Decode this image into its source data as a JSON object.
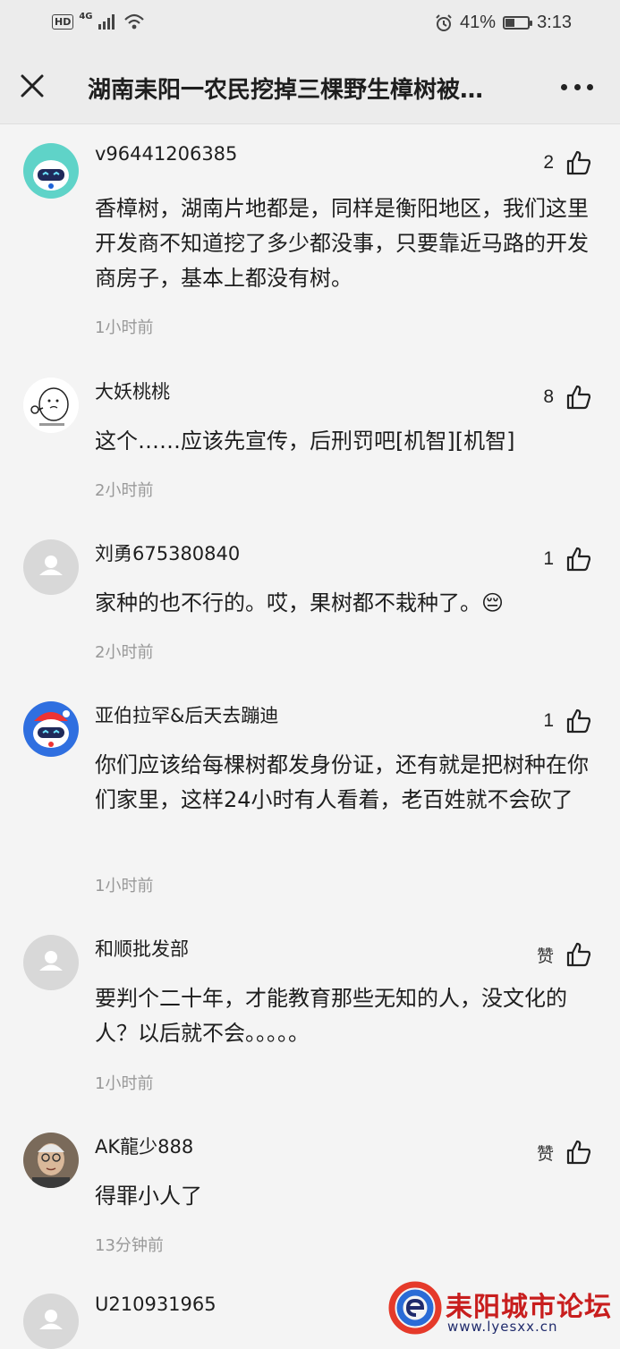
{
  "status_bar": {
    "signal": "4G",
    "battery": "41%",
    "battery_level": 0.41,
    "time": "3:13"
  },
  "header": {
    "title": "湖南耒阳一农民挖掉三棵野生樟树被…"
  },
  "comments": [
    {
      "username": "v96441206385",
      "likes": "2",
      "text": "香樟树，湖南片地都是，同样是衡阳地区，我们这里开发商不知道挖了多少都没事，只要靠近马路的开发商房子，基本上都没有树。",
      "time": "1小时前"
    },
    {
      "username": "大妖桃桃",
      "likes": "8",
      "text": "这个……应该先宣传，后刑罚吧[机智][机智]",
      "time": "2小时前"
    },
    {
      "username": "刘勇675380840",
      "likes": "1",
      "text": "家种的也不行的。哎，果树都不栽种了。😔",
      "time": "2小时前"
    },
    {
      "username": "亚伯拉罕&后天去蹦迪",
      "likes": "1",
      "text": "你们应该给每棵树都发身份证，还有就是把树种在你们家里，这样24小时有人看着，老百姓就不会砍了",
      "time": "1小时前"
    },
    {
      "username": "和顺批发部",
      "likes": "赞",
      "text": "要判个二十年，才能教育那些无知的人，没文化的人？以后就不会。。。。。",
      "time": "1小时前"
    },
    {
      "username": "AK龍少888",
      "likes": "赞",
      "text": "得罪小人了",
      "time": "13分钟前"
    },
    {
      "username": "U210931965",
      "likes": "",
      "text": "",
      "time": ""
    }
  ],
  "watermark": {
    "name": "耒阳城市论坛",
    "url": "www.lyesxx.cn"
  }
}
